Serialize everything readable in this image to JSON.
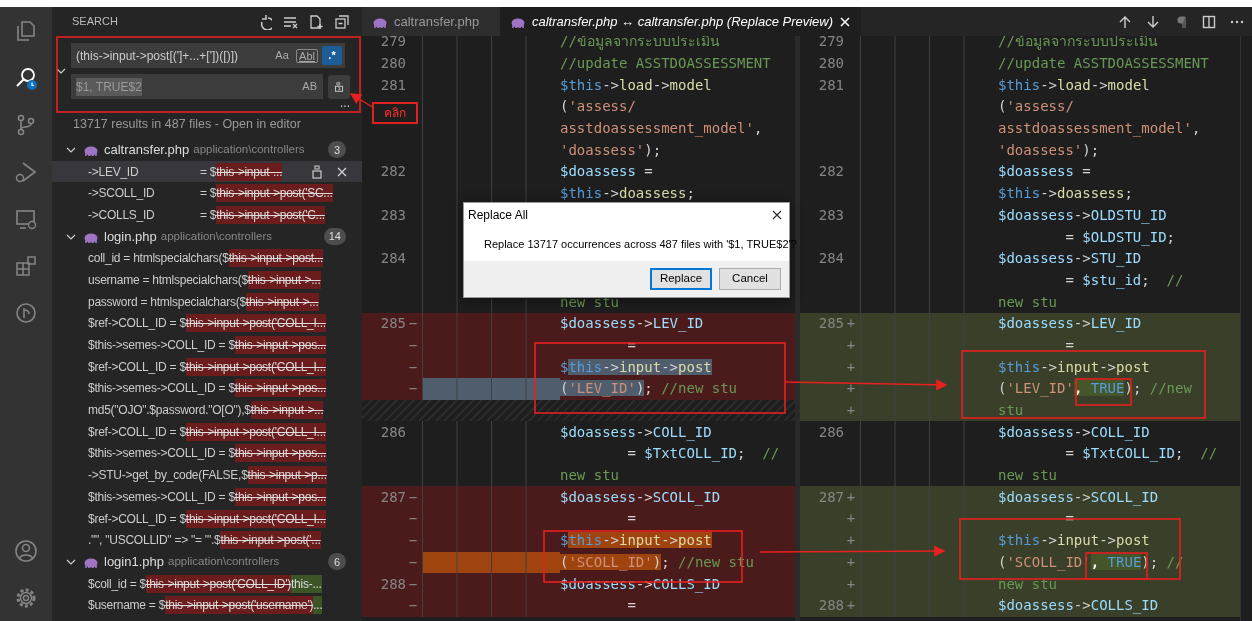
{
  "activity_bar": [
    {
      "kind": "files",
      "selected": false
    },
    {
      "kind": "search",
      "selected": true
    },
    {
      "kind": "source-control",
      "selected": false
    },
    {
      "kind": "run",
      "selected": false
    },
    {
      "kind": "remote",
      "selected": false
    },
    {
      "kind": "extensions",
      "selected": false
    },
    {
      "kind": "graph",
      "selected": false
    },
    {
      "kind": "account",
      "selected": false
    },
    {
      "kind": "settings",
      "selected": false
    }
  ],
  "sidebar": {
    "title": "SEARCH",
    "expanded": true,
    "find": {
      "value": "(this->input->post[(']+...+['])([)])",
      "toggles": [
        {
          "label": "Aa",
          "on": false
        },
        {
          "label": "Abl",
          "on": false
        },
        {
          "label": ".*",
          "on": true
        }
      ]
    },
    "replace": {
      "value": "$1, TRUE$2",
      "toggle": {
        "label": "AB",
        "on": false
      }
    },
    "more": "...",
    "summary": "13717 results in 487 files - ",
    "open_in_editor": "Open in editor",
    "groups": [
      {
        "file": "caltransfer.php",
        "path": "application\\controllers",
        "count": "3",
        "expanded": true,
        "matches": [
          {
            "lead": "->LEV_ID",
            "before": "= $",
            "removed": "this->input-...",
            "selected": true
          },
          {
            "lead": "->SCOLL_ID",
            "before": "= $",
            "removed": "this->input->post('SC...",
            "selected": false
          },
          {
            "lead": "->COLLS_ID",
            "before": "= $",
            "removed": "this->input->post('C...",
            "selected": false
          }
        ]
      },
      {
        "file": "login.php",
        "path": "application\\controllers",
        "count": "14",
        "expanded": true,
        "matches": [
          {
            "before": "coll_id = htmlspecialchars($",
            "removed": "this->input->post...",
            "selected": false
          },
          {
            "before": "username = htmlspecialchars($",
            "removed": "this->input->...",
            "selected": false
          },
          {
            "before": "password = htmlspecialchars($",
            "removed": "this->input->...",
            "selected": false
          },
          {
            "before": "$ref->COLL_ID = $",
            "removed": "this->input->post('COLL_I...",
            "selected": false
          },
          {
            "before": "$this->semes->COLL_ID = $",
            "removed": "this->input->pos...",
            "selected": false
          },
          {
            "before": "$ref->COLL_ID = $",
            "removed": "this->input->post('COLL_I...",
            "selected": false
          },
          {
            "before": "$this->semes->COLL_ID = $",
            "removed": "this->input->pos...",
            "selected": false
          },
          {
            "before": "md5(\"OJO\".$password.\"O[O\"),$",
            "removed": "this->input->...",
            "selected": false
          },
          {
            "before": "$ref->COLL_ID = $",
            "removed": "this->input->post('COLL_I...",
            "selected": false
          },
          {
            "before": "$this->semes->COLL_ID = $",
            "removed": "this->input->pos...",
            "selected": false
          },
          {
            "before": "->STU->get_by_code(FALSE,$",
            "removed": "this->input->p...",
            "selected": false
          },
          {
            "before": "$this->semes->COLL_ID = $",
            "removed": "this->input->pos...",
            "selected": false
          },
          {
            "before": "$ref->COLL_ID = $",
            "removed": "this->input->post('COLL_I...",
            "selected": false
          },
          {
            "before": ".\"\", \"USCOLLID\" => \"= '\".$",
            "removed": "this->input->post('...",
            "selected": false
          }
        ]
      },
      {
        "file": "login1.php",
        "path": "application\\controllers",
        "count": "6",
        "expanded": true,
        "matches": [
          {
            "before": "$coll_id = $",
            "removed": "this->input->post('COLL_ID')",
            "added": "this-...",
            "selected": false
          },
          {
            "before": "$username = $",
            "removed": "this->input->post('username')",
            "added": "...",
            "selected": false
          }
        ]
      }
    ]
  },
  "editor": {
    "tabs": [
      {
        "label": "caltransfer.php",
        "selected": false,
        "preview": false
      },
      {
        "label": "caltransfer.php ↔ caltransfer.php (Replace Preview)",
        "selected": true,
        "preview": true
      }
    ],
    "panes": [
      {
        "rows": [
          {
            "number": "279",
            "kind": "normal",
            "tokens": [
              {
                "text": "//ข้อมูลจากระบบประเมิน",
                "kind": "comment"
              }
            ]
          },
          {
            "number": "280",
            "kind": "normal",
            "tokens": [
              {
                "text": "//update ASSTDOASSESSMENT",
                "kind": "comment"
              }
            ]
          },
          {
            "number": "281",
            "kind": "normal",
            "tokens": [
              {
                "text": "$this",
                "kind": "this"
              },
              {
                "text": "->",
                "kind": "punct"
              },
              {
                "text": "load",
                "kind": "func"
              },
              {
                "text": "->",
                "kind": "punct"
              },
              {
                "text": "model",
                "kind": "func"
              }
            ]
          },
          {
            "kind": "normal",
            "tokens": [
              {
                "text": "(",
                "kind": "punct"
              },
              {
                "text": "'assess/",
                "kind": "str"
              }
            ]
          },
          {
            "kind": "normal",
            "tokens": [
              {
                "text": "asstdoassessment_model'",
                "kind": "str"
              },
              {
                "text": ",",
                "kind": "punct"
              }
            ]
          },
          {
            "kind": "normal",
            "tokens": [
              {
                "text": "'doassess'",
                "kind": "str"
              },
              {
                "text": ");",
                "kind": "punct"
              }
            ]
          },
          {
            "number": "282",
            "kind": "normal",
            "tokens": [
              {
                "text": "$doassess",
                "kind": "var"
              },
              {
                "text": " =",
                "kind": "punct"
              }
            ]
          },
          {
            "kind": "normal",
            "tokens": [
              {
                "text": "$this",
                "kind": "this"
              },
              {
                "text": "->",
                "kind": "punct"
              },
              {
                "text": "doassess",
                "kind": "func"
              },
              {
                "text": ";",
                "kind": "punct"
              }
            ]
          },
          {
            "number": "283",
            "kind": "normal",
            "tokens": []
          },
          {
            "kind": "normal",
            "tokens": []
          },
          {
            "number": "284",
            "kind": "normal",
            "tokens": []
          },
          {
            "kind": "normal",
            "tokens": []
          },
          {
            "kind": "normal",
            "tokens": [
              {
                "text": "new stu",
                "kind": "comment"
              }
            ]
          },
          {
            "number": "285",
            "marker": "−",
            "kind": "removed",
            "tokens": [
              {
                "text": "$doassess",
                "kind": "var"
              },
              {
                "text": "->",
                "kind": "punct"
              },
              {
                "text": "LEV_ID",
                "kind": "var"
              }
            ]
          },
          {
            "marker": "−",
            "kind": "removed",
            "tokens": [
              {
                "text": "        =",
                "kind": "punct"
              }
            ]
          },
          {
            "marker": "−",
            "kind": "removed",
            "tokens": [
              {
                "text": "$",
                "kind": "this"
              },
              {
                "text": "this",
                "kind": "this",
                "selected": true
              },
              {
                "text": "->",
                "kind": "punct",
                "selected": true
              },
              {
                "text": "input",
                "kind": "func",
                "selected": true
              },
              {
                "text": "->",
                "kind": "punct",
                "selected": true
              },
              {
                "text": "post",
                "kind": "func",
                "selected": true
              }
            ]
          },
          {
            "marker": "−",
            "kind": "removed",
            "selected": true,
            "tokens": [
              {
                "text": "(",
                "kind": "punct",
                "selected": true
              },
              {
                "text": "'LEV_ID'",
                "kind": "str",
                "selected": true
              },
              {
                "text": ")",
                "kind": "punct",
                "selected": true
              },
              {
                "text": "; ",
                "kind": "punct"
              },
              {
                "text": "//new stu",
                "kind": "comment"
              }
            ]
          },
          {
            "kind": "spacer",
            "tokens": []
          },
          {
            "number": "286",
            "kind": "normal",
            "tokens": [
              {
                "text": "$doassess",
                "kind": "var"
              },
              {
                "text": "->",
                "kind": "punct"
              },
              {
                "text": "COLL_ID",
                "kind": "var"
              }
            ]
          },
          {
            "kind": "normal",
            "tokens": [
              {
                "text": "        = ",
                "kind": "punct"
              },
              {
                "text": "$TxtCOLL_ID",
                "kind": "var"
              },
              {
                "text": ";  ",
                "kind": "punct"
              },
              {
                "text": "//",
                "kind": "comment"
              }
            ]
          },
          {
            "kind": "normal",
            "tokens": [
              {
                "text": "new stu",
                "kind": "comment"
              }
            ]
          },
          {
            "number": "287",
            "marker": "−",
            "kind": "removed",
            "tokens": [
              {
                "text": "$doassess",
                "kind": "var"
              },
              {
                "text": "->",
                "kind": "punct"
              },
              {
                "text": "SCOLL_ID",
                "kind": "var"
              }
            ]
          },
          {
            "marker": "−",
            "kind": "removed",
            "tokens": [
              {
                "text": "        =",
                "kind": "punct"
              }
            ]
          },
          {
            "marker": "−",
            "kind": "removed",
            "tokens": [
              {
                "text": "$",
                "kind": "this"
              },
              {
                "text": "this",
                "kind": "this",
                "find_match": true
              },
              {
                "text": "->",
                "kind": "punct",
                "find_match": true
              },
              {
                "text": "input",
                "kind": "func",
                "find_match": true
              },
              {
                "text": "->",
                "kind": "punct",
                "find_match": true
              },
              {
                "text": "post",
                "kind": "func",
                "find_match": true
              }
            ]
          },
          {
            "marker": "−",
            "kind": "removed",
            "find_match": true,
            "tokens": [
              {
                "text": "(",
                "kind": "punct",
                "find_match": true
              },
              {
                "text": "'SCOLL_ID'",
                "kind": "str",
                "find_match": true
              },
              {
                "text": ")",
                "kind": "punct",
                "find_match": true
              },
              {
                "text": "; ",
                "kind": "punct"
              },
              {
                "text": "//new stu",
                "kind": "comment"
              }
            ]
          },
          {
            "number": "288",
            "marker": "−",
            "kind": "removed",
            "tokens": [
              {
                "text": "$doassess",
                "kind": "var"
              },
              {
                "text": "->",
                "kind": "punct"
              },
              {
                "text": "COLLS_ID",
                "kind": "var"
              }
            ]
          },
          {
            "marker": "−",
            "kind": "removed",
            "tokens": [
              {
                "text": "        =",
                "kind": "punct"
              }
            ]
          }
        ]
      },
      {
        "rows": [
          {
            "number": "279",
            "kind": "normal",
            "tokens": [
              {
                "text": "//ข้อมูลจากระบบประเมิน",
                "kind": "comment"
              }
            ]
          },
          {
            "number": "280",
            "kind": "normal",
            "tokens": [
              {
                "text": "//update ASSTDOASSESSMENT",
                "kind": "comment"
              }
            ]
          },
          {
            "number": "281",
            "kind": "normal",
            "tokens": [
              {
                "text": "$this",
                "kind": "this"
              },
              {
                "text": "->",
                "kind": "punct"
              },
              {
                "text": "load",
                "kind": "func"
              },
              {
                "text": "->",
                "kind": "punct"
              },
              {
                "text": "model",
                "kind": "func"
              }
            ]
          },
          {
            "kind": "normal",
            "tokens": [
              {
                "text": "(",
                "kind": "punct"
              },
              {
                "text": "'assess/",
                "kind": "str"
              }
            ]
          },
          {
            "kind": "normal",
            "tokens": [
              {
                "text": "asstdoassessment_model'",
                "kind": "str"
              },
              {
                "text": ",",
                "kind": "punct"
              }
            ]
          },
          {
            "kind": "normal",
            "tokens": [
              {
                "text": "'doassess'",
                "kind": "str"
              },
              {
                "text": ");",
                "kind": "punct"
              }
            ]
          },
          {
            "number": "282",
            "kind": "normal",
            "tokens": [
              {
                "text": "$doassess",
                "kind": "var"
              },
              {
                "text": " =",
                "kind": "punct"
              }
            ]
          },
          {
            "kind": "normal",
            "tokens": [
              {
                "text": "$this",
                "kind": "this"
              },
              {
                "text": "->",
                "kind": "punct"
              },
              {
                "text": "doassess",
                "kind": "func"
              },
              {
                "text": ";",
                "kind": "punct"
              }
            ]
          },
          {
            "number": "283",
            "kind": "normal",
            "tokens": [
              {
                "text": "$doassess",
                "kind": "var"
              },
              {
                "text": "->",
                "kind": "punct"
              },
              {
                "text": "OLDSTU_ID",
                "kind": "var"
              }
            ]
          },
          {
            "kind": "normal",
            "tokens": [
              {
                "text": "        = ",
                "kind": "punct"
              },
              {
                "text": "$OLDSTU_ID",
                "kind": "var"
              },
              {
                "text": ";",
                "kind": "punct"
              }
            ]
          },
          {
            "number": "284",
            "kind": "normal",
            "tokens": [
              {
                "text": "$doassess",
                "kind": "var"
              },
              {
                "text": "->",
                "kind": "punct"
              },
              {
                "text": "STU_ID",
                "kind": "var"
              }
            ]
          },
          {
            "kind": "normal",
            "tokens": [
              {
                "text": "        = ",
                "kind": "punct"
              },
              {
                "text": "$stu_id",
                "kind": "var"
              },
              {
                "text": ";  ",
                "kind": "punct"
              },
              {
                "text": "//",
                "kind": "comment"
              }
            ]
          },
          {
            "kind": "normal",
            "tokens": [
              {
                "text": "new stu",
                "kind": "comment"
              }
            ]
          },
          {
            "number": "285",
            "marker": "+",
            "kind": "added",
            "tokens": [
              {
                "text": "$doassess",
                "kind": "var"
              },
              {
                "text": "->",
                "kind": "punct"
              },
              {
                "text": "LEV_ID",
                "kind": "var"
              }
            ]
          },
          {
            "marker": "+",
            "kind": "added",
            "tokens": [
              {
                "text": "        =",
                "kind": "punct"
              }
            ]
          },
          {
            "marker": "+",
            "kind": "added",
            "tokens": [
              {
                "text": "$this",
                "kind": "this"
              },
              {
                "text": "->",
                "kind": "punct"
              },
              {
                "text": "input",
                "kind": "func"
              },
              {
                "text": "->",
                "kind": "punct"
              },
              {
                "text": "post",
                "kind": "func"
              }
            ]
          },
          {
            "marker": "+",
            "kind": "added",
            "tokens": [
              {
                "text": "(",
                "kind": "punct"
              },
              {
                "text": "'LEV_ID'",
                "kind": "str"
              },
              {
                "text": ", ",
                "kind": "punct",
                "inserted": true
              },
              {
                "text": "TRUE",
                "kind": "const",
                "inserted": true
              },
              {
                "text": "); ",
                "kind": "punct"
              },
              {
                "text": "//new",
                "kind": "comment"
              }
            ]
          },
          {
            "marker": "+",
            "kind": "added",
            "tokens": [
              {
                "text": "stu",
                "kind": "comment"
              }
            ]
          },
          {
            "number": "286",
            "kind": "normal",
            "tokens": [
              {
                "text": "$doassess",
                "kind": "var"
              },
              {
                "text": "->",
                "kind": "punct"
              },
              {
                "text": "COLL_ID",
                "kind": "var"
              }
            ]
          },
          {
            "kind": "normal",
            "tokens": [
              {
                "text": "        = ",
                "kind": "punct"
              },
              {
                "text": "$TxtCOLL_ID",
                "kind": "var"
              },
              {
                "text": ";  ",
                "kind": "punct"
              },
              {
                "text": "//",
                "kind": "comment"
              }
            ]
          },
          {
            "kind": "normal",
            "tokens": [
              {
                "text": "new stu",
                "kind": "comment"
              }
            ]
          },
          {
            "number": "287",
            "marker": "+",
            "kind": "added",
            "tokens": [
              {
                "text": "$doassess",
                "kind": "var"
              },
              {
                "text": "->",
                "kind": "punct"
              },
              {
                "text": "SCOLL_ID",
                "kind": "var"
              }
            ]
          },
          {
            "marker": "+",
            "kind": "added",
            "tokens": [
              {
                "text": "        =",
                "kind": "punct"
              }
            ]
          },
          {
            "marker": "+",
            "kind": "added",
            "tokens": [
              {
                "text": "$this",
                "kind": "this"
              },
              {
                "text": "->",
                "kind": "punct"
              },
              {
                "text": "input",
                "kind": "func"
              },
              {
                "text": "->",
                "kind": "punct"
              },
              {
                "text": "post",
                "kind": "func"
              }
            ]
          },
          {
            "marker": "+",
            "kind": "added",
            "tokens": [
              {
                "text": "(",
                "kind": "punct"
              },
              {
                "text": "'SCOLL_ID'",
                "kind": "str"
              },
              {
                "text": ", ",
                "kind": "punct",
                "inserted": true
              },
              {
                "text": "TRUE",
                "kind": "const",
                "inserted": true
              },
              {
                "text": "); ",
                "kind": "punct"
              },
              {
                "text": "//",
                "kind": "comment"
              }
            ]
          },
          {
            "marker": "+",
            "kind": "added",
            "tokens": [
              {
                "text": "new stu",
                "kind": "comment"
              }
            ]
          },
          {
            "number": "288",
            "marker": "+",
            "kind": "added",
            "tokens": [
              {
                "text": "$doassess",
                "kind": "var"
              },
              {
                "text": "->",
                "kind": "punct"
              },
              {
                "text": "COLLS_ID",
                "kind": "var"
              }
            ]
          }
        ]
      }
    ]
  },
  "dialog": {
    "title": "Replace All",
    "message": "Replace 13717 occurrences across 487 files with '$1, TRUE$2'?",
    "buttons": [
      {
        "label": "Replace",
        "default": true
      },
      {
        "label": "Cancel",
        "default": false
      }
    ]
  },
  "annotation": {
    "label": "คลิก"
  }
}
